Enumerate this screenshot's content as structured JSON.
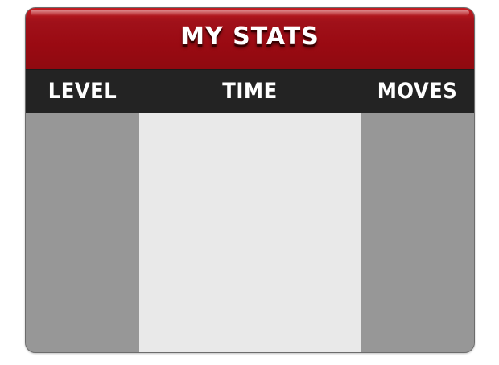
{
  "title": "MY STATS",
  "columns": {
    "level": "LEVEL",
    "time": "TIME",
    "moves": "MOVES"
  },
  "rows": [],
  "colors": {
    "title_bar": "#9a0a12",
    "header_row": "#232323",
    "side_columns": "#979797",
    "center_column": "#e9e9e9",
    "text": "#ffffff"
  }
}
